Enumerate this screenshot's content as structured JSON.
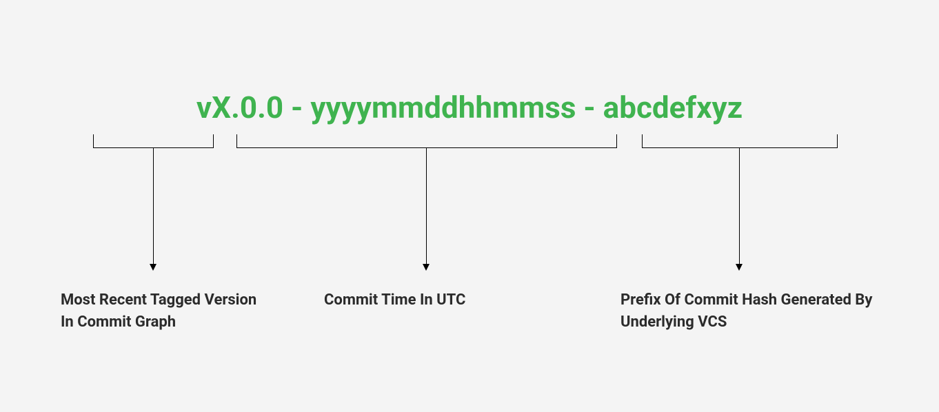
{
  "version_parts": {
    "part1": "vX.0.0",
    "sep": " - ",
    "part2": "yyyymmddhhmmss",
    "part3": "abcdefxyz"
  },
  "labels": {
    "label1": "Most Recent Tagged Version In Commit Graph",
    "label2": "Commit Time In UTC",
    "label3": "Prefix Of Commit Hash Generated By Underlying VCS"
  }
}
